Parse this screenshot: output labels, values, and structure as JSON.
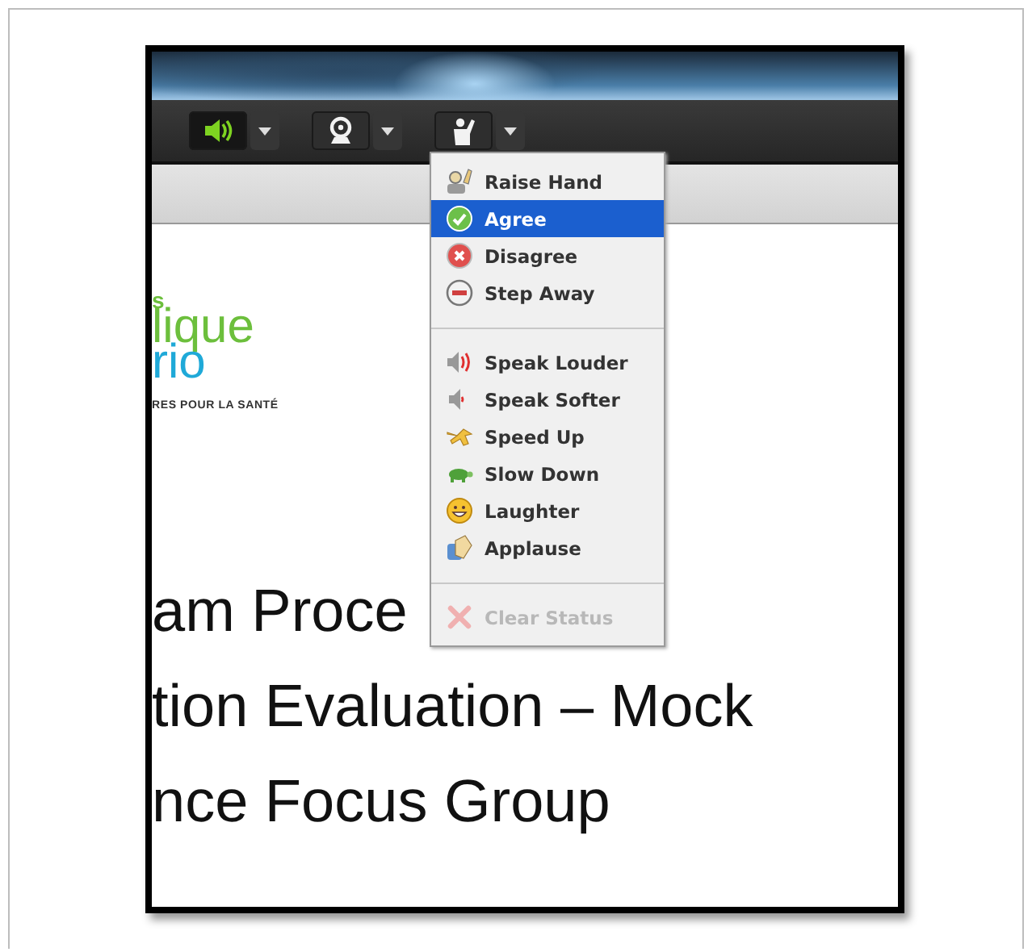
{
  "toolbar": [
    {
      "kind": "speaker",
      "on": true
    },
    {
      "kind": "camera",
      "on": false
    },
    {
      "kind": "status",
      "on": false
    }
  ],
  "logo": [
    {
      "text": "s",
      "color": "#6cbf3c"
    },
    {
      "text": "lique",
      "color": "#6cbf3c"
    },
    {
      "text": "rio",
      "color": "#1fa9d8"
    },
    {
      "text": "RES POUR LA SANTÉ",
      "color": "#333333"
    }
  ],
  "slide_lines": [
    "am Proce",
    "tion Evaluation – Mock",
    "nce Focus Group"
  ],
  "status_menu": {
    "sections": [
      {
        "items": [
          {
            "kind": "raise-hand",
            "label": "Raise Hand",
            "selected": false,
            "disabled": false
          },
          {
            "kind": "agree",
            "label": "Agree",
            "selected": true,
            "disabled": false
          },
          {
            "kind": "disagree",
            "label": "Disagree",
            "selected": false,
            "disabled": false
          },
          {
            "kind": "step-away",
            "label": "Step Away",
            "selected": false,
            "disabled": false
          }
        ]
      },
      {
        "items": [
          {
            "kind": "louder",
            "label": "Speak Louder",
            "selected": false,
            "disabled": false
          },
          {
            "kind": "softer",
            "label": "Speak Softer",
            "selected": false,
            "disabled": false
          },
          {
            "kind": "speed-up",
            "label": "Speed Up",
            "selected": false,
            "disabled": false
          },
          {
            "kind": "slow-down",
            "label": "Slow Down",
            "selected": false,
            "disabled": false
          },
          {
            "kind": "laughter",
            "label": "Laughter",
            "selected": false,
            "disabled": false
          },
          {
            "kind": "applause",
            "label": "Applause",
            "selected": false,
            "disabled": false
          }
        ]
      },
      {
        "items": [
          {
            "kind": "clear",
            "label": "Clear Status",
            "selected": false,
            "disabled": true
          }
        ]
      }
    ]
  }
}
